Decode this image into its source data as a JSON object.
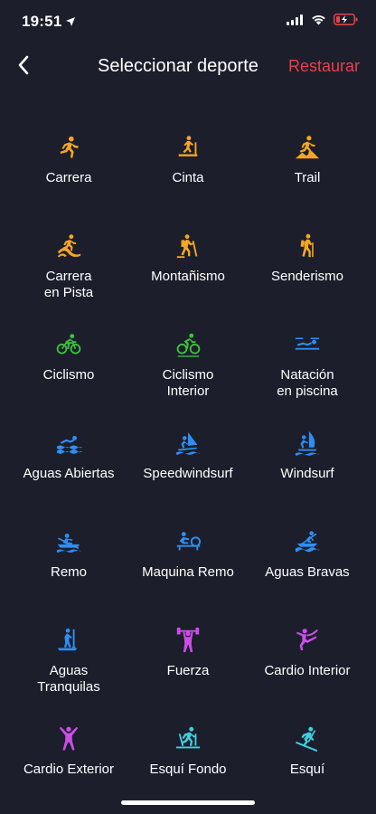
{
  "status_bar": {
    "time": "19:51",
    "location_icon": "location-arrow-icon",
    "signal_icon": "cellular-signal-icon",
    "wifi_icon": "wifi-icon",
    "battery_icon": "battery-low-charging-icon",
    "battery_color": "#e8404a"
  },
  "nav": {
    "back_icon": "chevron-left-icon",
    "title": "Seleccionar deporte",
    "restore_label": "Restaurar",
    "restore_color": "#e8404a"
  },
  "colors": {
    "background": "#1c1f2b",
    "orange": "#f5a623",
    "green": "#3cc13b",
    "blue": "#2f8ef4",
    "purple": "#cc4ee8",
    "cyan": "#3fd0e0"
  },
  "sports": [
    {
      "label": "Carrera",
      "icon": "running-icon",
      "color": "#f5a623"
    },
    {
      "label": "Cinta",
      "icon": "treadmill-icon",
      "color": "#f5a623"
    },
    {
      "label": "Trail",
      "icon": "trail-running-icon",
      "color": "#f5a623"
    },
    {
      "label": "Carrera\nen Pista",
      "icon": "track-running-icon",
      "color": "#f5a623"
    },
    {
      "label": "Montañismo",
      "icon": "mountaineering-icon",
      "color": "#f5a623"
    },
    {
      "label": "Senderismo",
      "icon": "hiking-icon",
      "color": "#f5a623"
    },
    {
      "label": "Ciclismo",
      "icon": "cycling-icon",
      "color": "#3cc13b"
    },
    {
      "label": "Ciclismo\nInterior",
      "icon": "indoor-cycling-icon",
      "color": "#3cc13b"
    },
    {
      "label": "Natación\nen piscina",
      "icon": "pool-swimming-icon",
      "color": "#2f8ef4"
    },
    {
      "label": "Aguas Abiertas",
      "icon": "open-water-swimming-icon",
      "color": "#2f8ef4"
    },
    {
      "label": "Speedwindsurf",
      "icon": "speed-windsurf-icon",
      "color": "#2f8ef4"
    },
    {
      "label": "Windsurf",
      "icon": "windsurf-icon",
      "color": "#2f8ef4"
    },
    {
      "label": "Remo",
      "icon": "rowing-icon",
      "color": "#2f8ef4"
    },
    {
      "label": "Maquina Remo",
      "icon": "rowing-machine-icon",
      "color": "#2f8ef4"
    },
    {
      "label": "Aguas Bravas",
      "icon": "whitewater-icon",
      "color": "#2f8ef4"
    },
    {
      "label": "Aguas\nTranquilas",
      "icon": "paddleboard-icon",
      "color": "#2f8ef4"
    },
    {
      "label": "Fuerza",
      "icon": "weightlifting-icon",
      "color": "#cc4ee8"
    },
    {
      "label": "Cardio Interior",
      "icon": "indoor-cardio-icon",
      "color": "#cc4ee8"
    },
    {
      "label": "Cardio Exterior",
      "icon": "outdoor-cardio-icon",
      "color": "#cc4ee8"
    },
    {
      "label": "Esquí Fondo",
      "icon": "cross-country-ski-icon",
      "color": "#3fd0e0"
    },
    {
      "label": "Esquí",
      "icon": "ski-icon",
      "color": "#3fd0e0"
    }
  ]
}
